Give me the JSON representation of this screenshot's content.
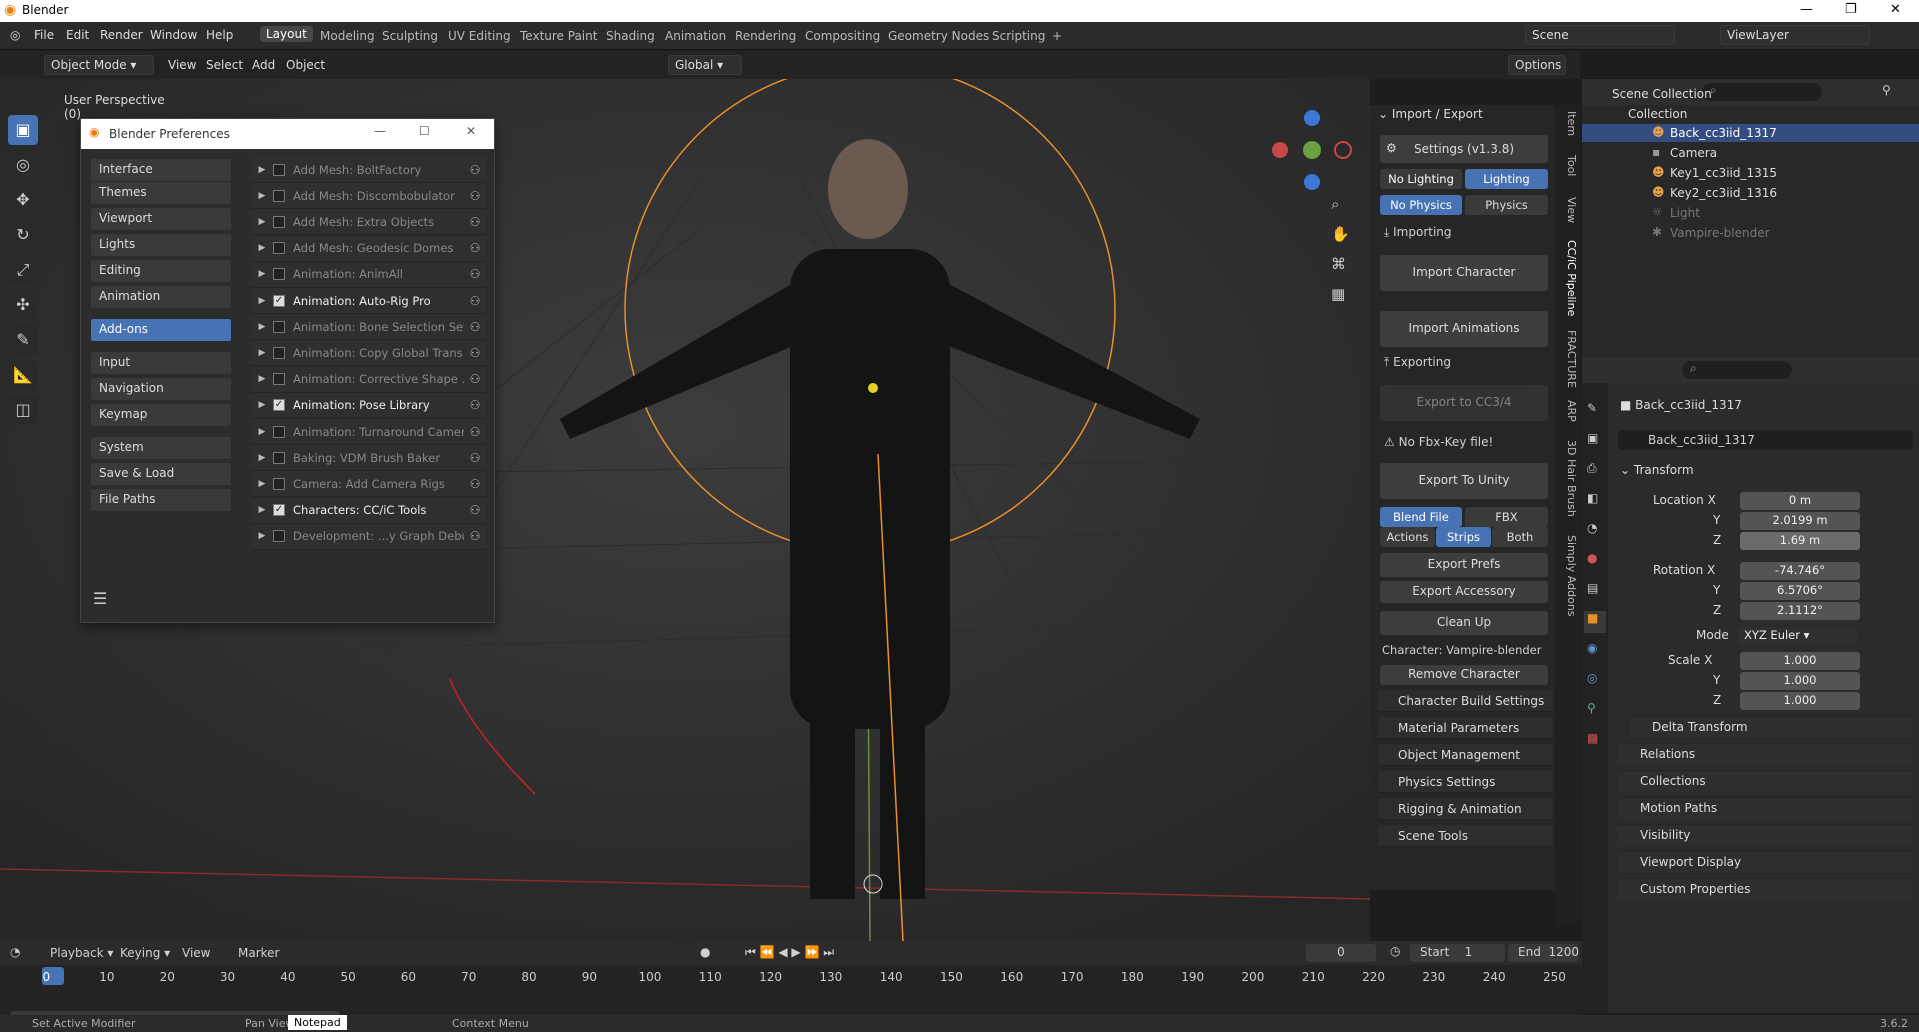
{
  "window": {
    "title": "Blender"
  },
  "menu": [
    "File",
    "Edit",
    "Render",
    "Window",
    "Help"
  ],
  "workspaces": [
    "Layout",
    "Modeling",
    "Sculpting",
    "UV Editing",
    "Texture Paint",
    "Shading",
    "Animation",
    "Rendering",
    "Compositing",
    "Geometry Nodes",
    "Scripting"
  ],
  "scene": "Scene",
  "view_layer": "ViewLayer",
  "header": {
    "mode": "Object Mode",
    "view": "View",
    "select": "Select",
    "add": "Add",
    "object": "Object",
    "transform": "Global",
    "options": "Options"
  },
  "viewport": {
    "perspective": "User Perspective",
    "collection": "(0)"
  },
  "prefs": {
    "title": "Blender Preferences",
    "cats1": [
      "Interface",
      "Themes",
      "Viewport",
      "Lights",
      "Editing",
      "Animation"
    ],
    "active": "Add-ons",
    "cats2": [
      "Input",
      "Navigation",
      "Keymap"
    ],
    "cats3": [
      "System",
      "Save & Load",
      "File Paths"
    ],
    "addons": [
      {
        "name": "Add Mesh: BoltFactory",
        "on": false
      },
      {
        "name": "Add Mesh: Discombobulator",
        "on": false
      },
      {
        "name": "Add Mesh: Extra Objects",
        "on": false
      },
      {
        "name": "Add Mesh: Geodesic Domes",
        "on": false
      },
      {
        "name": "Animation: AnimAll",
        "on": false
      },
      {
        "name": "Animation: Auto-Rig Pro",
        "on": true
      },
      {
        "name": "Animation: Bone Selection Sets",
        "on": false
      },
      {
        "name": "Animation: Copy Global Trans...",
        "on": false
      },
      {
        "name": "Animation: Corrective Shape ...",
        "on": false
      },
      {
        "name": "Animation: Pose Library",
        "on": true
      },
      {
        "name": "Animation: Turnaround Camera",
        "on": false
      },
      {
        "name": "Baking: VDM Brush Baker",
        "on": false
      },
      {
        "name": "Camera: Add Camera Rigs",
        "on": false
      },
      {
        "name": "Characters: CC/iC Tools",
        "on": true
      },
      {
        "name": "Development: ...y Graph Debug",
        "on": false
      }
    ]
  },
  "cc": {
    "section": "Import / Export",
    "settings": "Settings  (v1.3.8)",
    "no_lighting": "No Lighting",
    "lighting": "Lighting",
    "no_physics": "No Physics",
    "physics": "Physics",
    "importing": "Importing",
    "import_character": "Import Character",
    "import_animations": "Import Animations",
    "exporting": "Exporting",
    "export_cc": "Export to CC3/4",
    "no_fbx": "No Fbx-Key file!",
    "export_unity": "Export To Unity",
    "blend_file": "Blend File",
    "fbx": "FBX",
    "actions": "Actions",
    "strips": "Strips",
    "both": "Both",
    "export_prefs": "Export Prefs",
    "export_accessory": "Export Accessory",
    "clean_up": "Clean Up",
    "character": "Character: Vampire-blender",
    "remove": "Remove Character",
    "sections": [
      "Character Build Settings",
      "Material Parameters",
      "Object Management",
      "Physics Settings",
      "Rigging & Animation",
      "Scene Tools"
    ]
  },
  "vtabs": [
    "Item",
    "Tool",
    "View",
    "CC/iC Pipeline",
    "FRACTURE",
    "ARP",
    "3D Hair Brush",
    "Simply Addons"
  ],
  "outliner": {
    "root": "Scene Collection",
    "collection": "Collection",
    "items": [
      "Back_cc3iid_1317",
      "Camera",
      "Key1_cc3iid_1315",
      "Key2_cc3iid_1316",
      "Light",
      "Vampire-blender"
    ]
  },
  "props": {
    "object": "Back_cc3iid_1317",
    "data": "Back_cc3iid_1317",
    "transform": "Transform",
    "loc_label": "Location X",
    "loc": [
      "0 m",
      "2.0199 m",
      "1.69 m"
    ],
    "rot_label": "Rotation X",
    "rot": [
      "-74.746°",
      "6.5706°",
      "2.1112°"
    ],
    "mode_label": "Mode",
    "mode": "XYZ Euler",
    "scale_label": "Scale X",
    "scale": [
      "1.000",
      "1.000",
      "1.000"
    ],
    "y": "Y",
    "z": "Z",
    "sections": [
      "Delta Transform",
      "Relations",
      "Collections",
      "Motion Paths",
      "Visibility",
      "Viewport Display",
      "Custom Properties"
    ]
  },
  "timeline": {
    "playback": "Playback",
    "keying": "Keying",
    "view": "View",
    "marker": "Marker",
    "frame": "0",
    "start_label": "Start",
    "start": "1",
    "end_label": "End",
    "end": "1200",
    "ticks": [
      "0",
      "10",
      "20",
      "30",
      "40",
      "50",
      "60",
      "70",
      "80",
      "90",
      "100",
      "110",
      "120",
      "130",
      "140",
      "150",
      "160",
      "170",
      "180",
      "190",
      "200",
      "210",
      "220",
      "230",
      "240",
      "250"
    ]
  },
  "status": {
    "left": "Set Active Modifier",
    "pan": "Pan View",
    "notepad": "Notepad",
    "ctx": "Context Menu",
    "version": "3.6.2"
  }
}
